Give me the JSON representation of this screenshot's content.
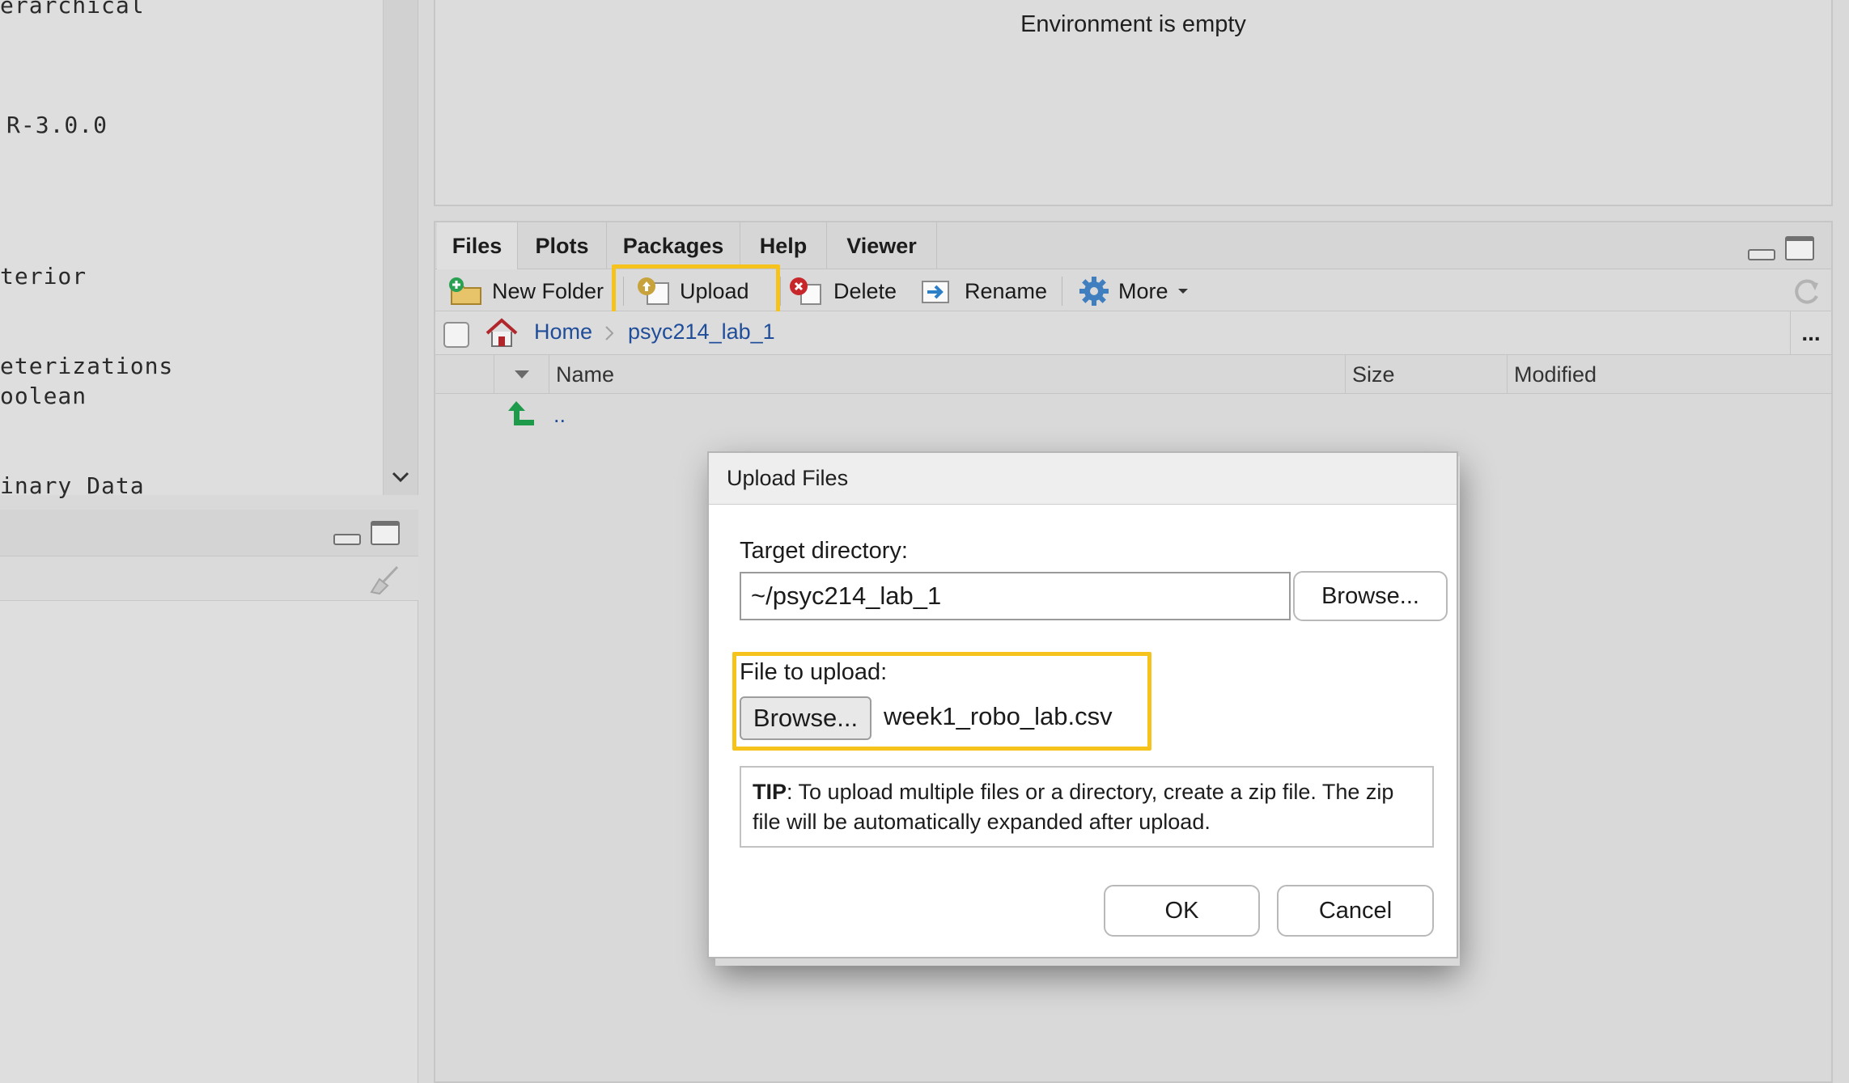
{
  "left_panel": {
    "code_lines": [
      "erarchical",
      "R-3.0.0",
      "terior",
      "eterizations",
      "oolean",
      "inary Data"
    ]
  },
  "environment": {
    "empty_text": "Environment is empty"
  },
  "files_pane": {
    "tabs": [
      "Files",
      "Plots",
      "Packages",
      "Help",
      "Viewer"
    ],
    "toolbar": {
      "new_folder": "New Folder",
      "upload": "Upload",
      "delete": "Delete",
      "rename": "Rename",
      "more": "More"
    },
    "breadcrumb": {
      "home": "Home",
      "folder": "psyc214_lab_1",
      "overflow": "..."
    },
    "columns": {
      "name": "Name",
      "size": "Size",
      "modified": "Modified"
    },
    "rows": [
      {
        "name": ".."
      }
    ]
  },
  "dialog": {
    "title": "Upload Files",
    "target_label": "Target directory:",
    "target_value": "~/psyc214_lab_1",
    "browse_dir": "Browse...",
    "file_label": "File to upload:",
    "browse_file": "Browse...",
    "file_name": "week1_robo_lab.csv",
    "tip_bold": "TIP",
    "tip_text": ": To upload multiple files or a directory, create a zip file. The zip file will be automatically expanded after upload.",
    "ok": "OK",
    "cancel": "Cancel"
  },
  "colors": {
    "highlight": "#f6c31c",
    "link": "#1f4d9a",
    "upload_arrow": "#1e9a4b"
  }
}
